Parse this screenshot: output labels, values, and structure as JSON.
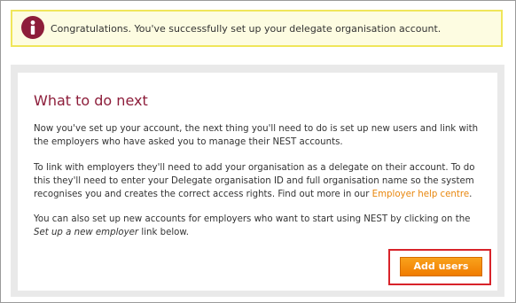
{
  "notice": {
    "icon": "info-icon",
    "icon_color": "#8d1d3a",
    "text": "Congratulations. You've successfully set up your delegate organisation account."
  },
  "panel": {
    "heading": "What to do next",
    "paragraph1": "Now you've set up your account, the next thing you'll need to do is set up new users and link with the employers who have asked you to manage their NEST accounts.",
    "paragraph2_before_link": "To link with employers they'll need to add your organisation as a delegate on their account. To do this they'll need to enter your Delegate organisation ID and full organisation name so the system recognises you and creates the correct access rights. Find out more in our ",
    "paragraph2_link": "Employer help centre",
    "paragraph2_after_link": ".",
    "paragraph3_before_em": "You can also set up new accounts for employers who want to start using NEST by clicking on the ",
    "paragraph3_em": "Set up a new employer",
    "paragraph3_after_em": " link below."
  },
  "actions": {
    "add_users_label": "Add users"
  },
  "colors": {
    "accent": "#8d1d3a",
    "link": "#e8860c",
    "button": "#f39200",
    "highlight": "#d8232a",
    "notice_border": "#f0e65a"
  }
}
